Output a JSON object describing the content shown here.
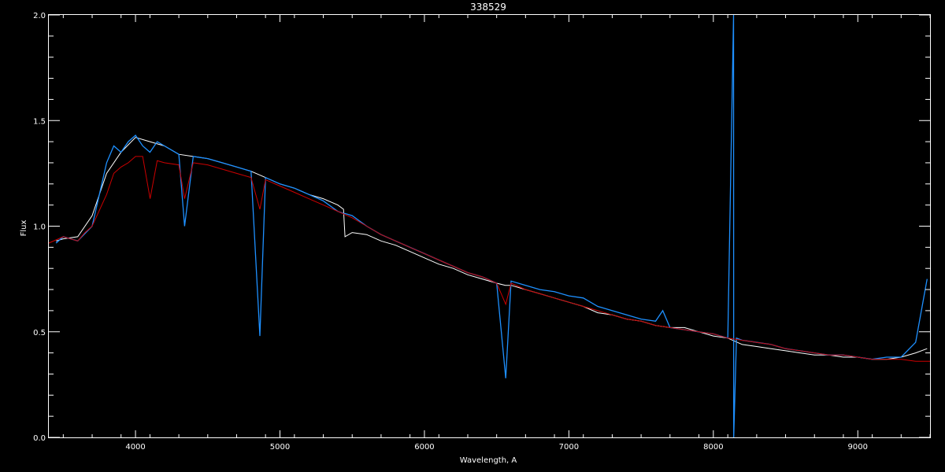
{
  "chart_data": {
    "type": "line",
    "title": "338529",
    "xlabel": "Wavelength, A",
    "ylabel": "Flux",
    "xlim": [
      3400,
      9500
    ],
    "ylim": [
      0.0,
      2.0
    ],
    "x_ticks": [
      4000,
      5000,
      6000,
      7000,
      8000,
      9000
    ],
    "y_ticks": [
      0.0,
      0.5,
      1.0,
      1.5,
      2.0
    ],
    "x_tick_labels": [
      "4000",
      "5000",
      "6000",
      "7000",
      "8000",
      "9000"
    ],
    "y_tick_labels": [
      "0.0",
      "0.5",
      "1.0",
      "1.5",
      "2.0"
    ],
    "grid": false,
    "background": "#000000",
    "series": [
      {
        "color": "#ffffff",
        "x": [
          3450,
          3500,
          3600,
          3700,
          3800,
          3900,
          4000,
          4100,
          4200,
          4300,
          4400,
          4500,
          4600,
          4700,
          4800,
          4900,
          5000,
          5100,
          5200,
          5300,
          5400,
          5440,
          5450,
          5500,
          5600,
          5700,
          5800,
          5900,
          6000,
          6100,
          6200,
          6300,
          6400,
          6500,
          6560,
          6600,
          6700,
          6800,
          6900,
          7000,
          7100,
          7200,
          7300,
          7400,
          7500,
          7600,
          7700,
          7800,
          7900,
          8000,
          8100,
          8200,
          8300,
          8400,
          8500,
          8600,
          8700,
          8800,
          8900,
          9000,
          9100,
          9200,
          9300,
          9400,
          9480
        ],
        "y": [
          0.93,
          0.94,
          0.95,
          1.05,
          1.25,
          1.35,
          1.42,
          1.4,
          1.38,
          1.34,
          1.33,
          1.32,
          1.3,
          1.28,
          1.26,
          1.23,
          1.2,
          1.18,
          1.15,
          1.13,
          1.1,
          1.08,
          0.95,
          0.97,
          0.96,
          0.93,
          0.91,
          0.88,
          0.85,
          0.82,
          0.8,
          0.77,
          0.75,
          0.73,
          0.72,
          0.72,
          0.7,
          0.68,
          0.66,
          0.64,
          0.62,
          0.59,
          0.58,
          0.56,
          0.55,
          0.53,
          0.52,
          0.52,
          0.5,
          0.48,
          0.47,
          0.44,
          0.43,
          0.42,
          0.41,
          0.4,
          0.39,
          0.39,
          0.38,
          0.38,
          0.37,
          0.37,
          0.38,
          0.4,
          0.42
        ]
      },
      {
        "color": "#1e90ff",
        "x": [
          3450,
          3500,
          3600,
          3700,
          3750,
          3800,
          3850,
          3900,
          3950,
          4000,
          4050,
          4100,
          4150,
          4200,
          4300,
          4340,
          4400,
          4500,
          4600,
          4700,
          4800,
          4861,
          4900,
          5000,
          5100,
          5200,
          5300,
          5400,
          5440,
          5450,
          5500,
          5600,
          5700,
          5800,
          5900,
          6000,
          6100,
          6200,
          6300,
          6400,
          6500,
          6563,
          6600,
          6700,
          6800,
          6900,
          7000,
          7100,
          7200,
          7300,
          7400,
          7500,
          7600,
          7650,
          7700,
          7800,
          7900,
          8000,
          8100,
          8140,
          8141,
          8160,
          8200,
          8300,
          8400,
          8500,
          8600,
          8700,
          8800,
          8900,
          9000,
          9100,
          9200,
          9300,
          9400,
          9480
        ],
        "y": [
          0.92,
          0.95,
          0.93,
          1.0,
          1.15,
          1.3,
          1.38,
          1.35,
          1.4,
          1.43,
          1.38,
          1.35,
          1.4,
          1.38,
          1.34,
          1.0,
          1.33,
          1.32,
          1.3,
          1.28,
          1.26,
          0.48,
          1.23,
          1.2,
          1.18,
          1.15,
          1.12,
          1.07,
          1.06,
          1.06,
          1.05,
          1.0,
          0.96,
          0.93,
          0.9,
          0.87,
          0.84,
          0.81,
          0.78,
          0.76,
          0.73,
          0.28,
          0.74,
          0.72,
          0.7,
          0.69,
          0.67,
          0.66,
          0.62,
          0.6,
          0.58,
          0.56,
          0.55,
          0.6,
          0.52,
          0.51,
          0.5,
          0.49,
          0.47,
          2.0,
          0.0,
          0.47,
          0.46,
          0.45,
          0.44,
          0.42,
          0.41,
          0.4,
          0.39,
          0.39,
          0.38,
          0.37,
          0.38,
          0.38,
          0.45,
          0.75
        ]
      },
      {
        "color": "#cc0000",
        "x": [
          3400,
          3500,
          3600,
          3650,
          3700,
          3800,
          3850,
          3900,
          3950,
          4000,
          4050,
          4101,
          4150,
          4200,
          4300,
          4340,
          4400,
          4500,
          4600,
          4700,
          4800,
          4861,
          4900,
          5000,
          5100,
          5200,
          5300,
          5400,
          5500,
          5600,
          5700,
          5800,
          5900,
          6000,
          6100,
          6200,
          6300,
          6400,
          6500,
          6563,
          6600,
          6700,
          6800,
          6900,
          7000,
          7100,
          7200,
          7300,
          7400,
          7500,
          7600,
          7700,
          7800,
          7900,
          8000,
          8100,
          8200,
          8300,
          8400,
          8500,
          8600,
          8700,
          8800,
          8900,
          9000,
          9100,
          9200,
          9300,
          9400,
          9500
        ],
        "y": [
          0.92,
          0.95,
          0.93,
          0.97,
          1.0,
          1.15,
          1.25,
          1.28,
          1.3,
          1.33,
          1.33,
          1.13,
          1.31,
          1.3,
          1.29,
          1.13,
          1.3,
          1.29,
          1.27,
          1.25,
          1.23,
          1.08,
          1.22,
          1.19,
          1.16,
          1.13,
          1.1,
          1.07,
          1.04,
          1.0,
          0.96,
          0.93,
          0.9,
          0.87,
          0.84,
          0.81,
          0.78,
          0.76,
          0.73,
          0.63,
          0.73,
          0.7,
          0.68,
          0.66,
          0.64,
          0.62,
          0.6,
          0.58,
          0.56,
          0.55,
          0.53,
          0.52,
          0.51,
          0.5,
          0.49,
          0.47,
          0.46,
          0.45,
          0.44,
          0.42,
          0.41,
          0.4,
          0.39,
          0.39,
          0.38,
          0.37,
          0.37,
          0.37,
          0.36,
          0.36
        ]
      }
    ]
  }
}
